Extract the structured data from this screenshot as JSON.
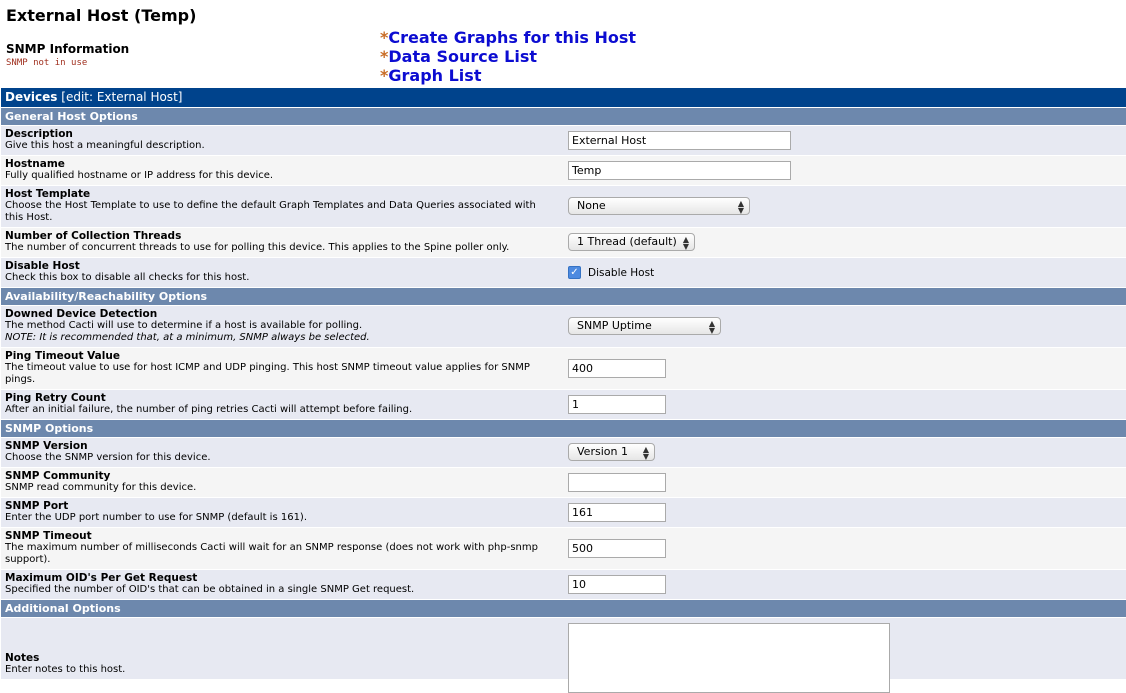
{
  "page_title": "External Host (Temp)",
  "snmp_info": {
    "heading": "SNMP Information",
    "status": "SNMP not in use"
  },
  "links": [
    {
      "star": "*",
      "label": "Create Graphs for this Host"
    },
    {
      "star": "*",
      "label": "Data Source List"
    },
    {
      "star": "*",
      "label": "Graph List"
    }
  ],
  "devices_bar": {
    "title": "Devices",
    "edit": "[edit: External Host]"
  },
  "sections": {
    "general": "General Host Options",
    "availability": "Availability/Reachability Options",
    "snmp": "SNMP Options",
    "additional": "Additional Options"
  },
  "fields": {
    "description": {
      "title": "Description",
      "desc": "Give this host a meaningful description.",
      "value": "External Host"
    },
    "hostname": {
      "title": "Hostname",
      "desc": "Fully qualified hostname or IP address for this device.",
      "value": "Temp"
    },
    "host_template": {
      "title": "Host Template",
      "desc": "Choose the Host Template to use to define the default Graph Templates and Data Queries associated with this Host.",
      "value": "None"
    },
    "threads": {
      "title": "Number of Collection Threads",
      "desc": "The number of concurrent threads to use for polling this device. This applies to the Spine poller only.",
      "value": "1 Thread (default)"
    },
    "disable_host": {
      "title": "Disable Host",
      "desc": "Check this box to disable all checks for this host.",
      "checkbox_label": "Disable Host",
      "checked": true
    },
    "downed_detection": {
      "title": "Downed Device Detection",
      "desc": "The method Cacti will use to determine if a host is available for polling.",
      "note": "NOTE: It is recommended that, at a minimum, SNMP always be selected.",
      "value": "SNMP Uptime"
    },
    "ping_timeout": {
      "title": "Ping Timeout Value",
      "desc": "The timeout value to use for host ICMP and UDP pinging. This host SNMP timeout value applies for SNMP pings.",
      "value": "400"
    },
    "ping_retry": {
      "title": "Ping Retry Count",
      "desc": "After an initial failure, the number of ping retries Cacti will attempt before failing.",
      "value": "1"
    },
    "snmp_version": {
      "title": "SNMP Version",
      "desc": "Choose the SNMP version for this device.",
      "value": "Version 1"
    },
    "snmp_community": {
      "title": "SNMP Community",
      "desc": "SNMP read community for this device.",
      "value": ""
    },
    "snmp_port": {
      "title": "SNMP Port",
      "desc": "Enter the UDP port number to use for SNMP (default is 161).",
      "value": "161"
    },
    "snmp_timeout": {
      "title": "SNMP Timeout",
      "desc": "The maximum number of milliseconds Cacti will wait for an SNMP response (does not work with php-snmp support).",
      "value": "500"
    },
    "max_oids": {
      "title": "Maximum OID's Per Get Request",
      "desc": "Specified the number of OID's that can be obtained in a single SNMP Get request.",
      "value": "10"
    },
    "notes": {
      "title": "Notes",
      "desc": "Enter notes to this host.",
      "value": ""
    }
  },
  "icons": {
    "select_arrow": "select-arrow-icon",
    "check": "checkmark-icon"
  },
  "colors": {
    "devices_bar": "#00438c",
    "section_header": "#6d88ad",
    "link": "#0c0cd1",
    "star": "#c96d27",
    "status": "#a0301f"
  }
}
